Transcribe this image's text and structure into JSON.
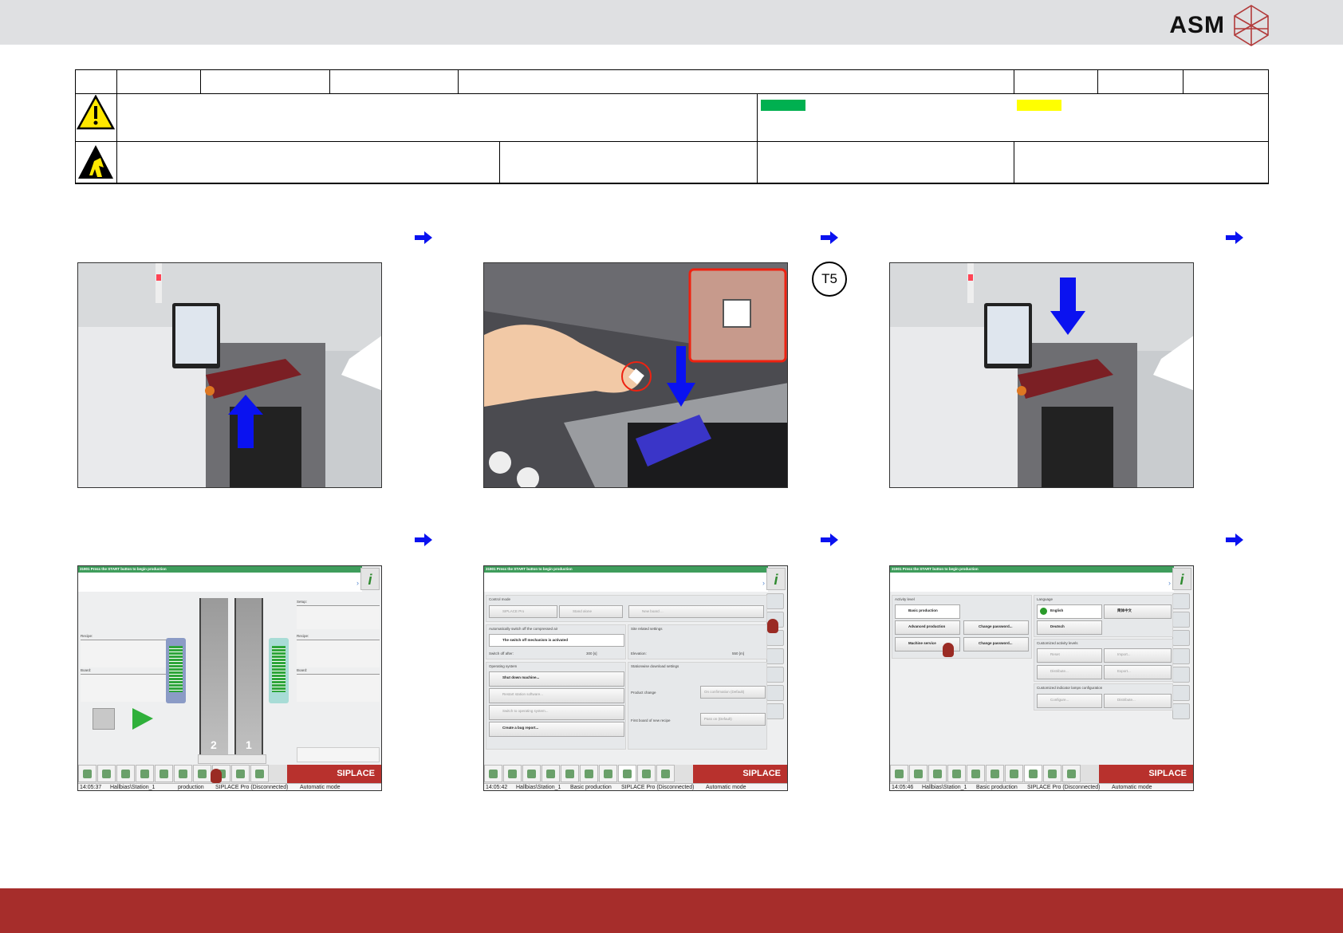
{
  "header": {
    "logo_text": "ASM",
    "colors": {
      "bar": "#dfe0e2",
      "footer": "#a62d2b",
      "green_swatch": "#00b050",
      "yellow_swatch": "#ffff00"
    }
  },
  "icons": {
    "warning": "warning-triangle-icon",
    "esd": "esd-warning-icon",
    "step_arrow": "arrow-right-icon"
  },
  "tool_marker": "T5",
  "screens": {
    "status_message": "31901 Press the START button to begin production",
    "brand": "SIPLACE",
    "info_icon": "i",
    "status_bar": {
      "line": "Hallbias\\Station_1",
      "level": "Basic production",
      "pro": "SIPLACE Pro (Disconnected)",
      "mode": "Automatic mode"
    },
    "s1": {
      "time": "14:05:37",
      "setup": "Setup:",
      "recipe_left": "Recipe:",
      "board_left": "Board:",
      "recipe_right": "Recipe:",
      "board_right": "Board:",
      "lane2": "2",
      "lane1": "1",
      "level_partial": "production"
    },
    "s2": {
      "time": "14:05:42",
      "control_mode": "Control mode",
      "siplace_pro": "SIPLACE Pro",
      "stand_alone": "Stand alone",
      "new_board": "New board ...",
      "compressed_air": "Automatically switch off the compressed air",
      "switch_off_active": "The switch off mechanism is activated",
      "switch_off_after": "Switch off after:",
      "switch_off_value": "300 [s]",
      "site_settings": "Site related settings",
      "elevation": "Elevation:",
      "elevation_value": "550 [m]",
      "operating_system": "Operating system",
      "shut_down": "Shut down machine...",
      "restart": "Restart station software...",
      "switch_os": "Switch to operating system...",
      "bug_report": "Create a bug report...",
      "download_settings": "Stationwise download settings",
      "product_change": "Product change",
      "product_change_value": "On confirmation (Default)",
      "first_board": "First board of new recipe",
      "first_board_value": "Pass on (Default)"
    },
    "s3": {
      "time": "14:05:46",
      "activity_level": "Activity level",
      "basic": "Basic production",
      "advanced": "Advanced production",
      "service": "Machine service",
      "change_pw": "Change password...",
      "language": "Language",
      "english": "English",
      "chinese": "简体中文",
      "deutsch": "Deutsch",
      "custom_levels": "Customized activity levels",
      "reset": "Reset",
      "import": "Import...",
      "distribute": "Distribute...",
      "export": "Export...",
      "custom_lamps": "Customized indicator lamps configuration",
      "configure": "Configure..."
    }
  }
}
